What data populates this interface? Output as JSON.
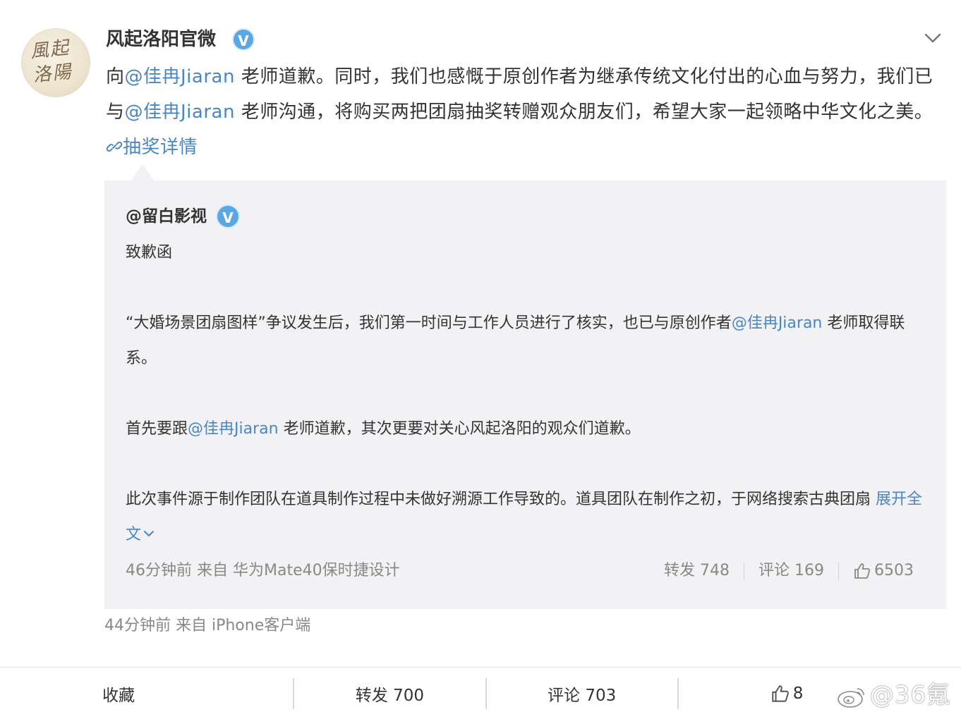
{
  "post": {
    "author": "风起洛阳官微",
    "avatar_text": "風起洛陽",
    "text_part1": "向",
    "mention": "@佳冉Jiaran",
    "text_part2": " 老师道歉。同时，我们也感慨于原创作者为继承传统文化付出的心血与努力，我们已与",
    "text_part3": " 老师沟通，将购买两把团扇抽奖转赠观众朋友们，希望大家一起领略中华文化之美。",
    "link_label": "抽奖详情",
    "meta": "44分钟前  来自 iPhone客户端"
  },
  "quoted": {
    "author": "@留白影视",
    "title": "致歉函",
    "para1_a": "“大婚场景团扇图样”争议发生后，我们第一时间与工作人员进行了核实，也已与原创作者",
    "mention": "@佳冉Jiaran",
    "para1_b": " 老师取得联系。",
    "para2_a": "首先要跟",
    "para2_b": " 老师道歉，其次更要对关心风起洛阳的观众们道歉。",
    "para3": "此次事件源于制作团队在道具制作过程中未做好溯源工作导致的。道具团队在制作之初，于网络搜索古典团扇 ",
    "expand_label": "展开全文",
    "meta": "46分钟前 来自 华为Mate40保时捷设计",
    "repost_label": "转发 748",
    "comment_label": "评论 169",
    "like_count": "6503"
  },
  "bottom_bar": {
    "favorite": "收藏",
    "repost": "转发 700",
    "comment": "评论 703",
    "like_count": "8"
  },
  "watermark": "@36氪",
  "colors": {
    "link": "#4b86c4",
    "verified": "#5aa7e4",
    "quote_bg": "#f2f2f5",
    "meta_text": "#888888"
  },
  "icons": [
    "verified-badge-icon",
    "chevron-down-icon",
    "link-icon",
    "thumbs-up-icon",
    "weibo-logo-icon"
  ]
}
